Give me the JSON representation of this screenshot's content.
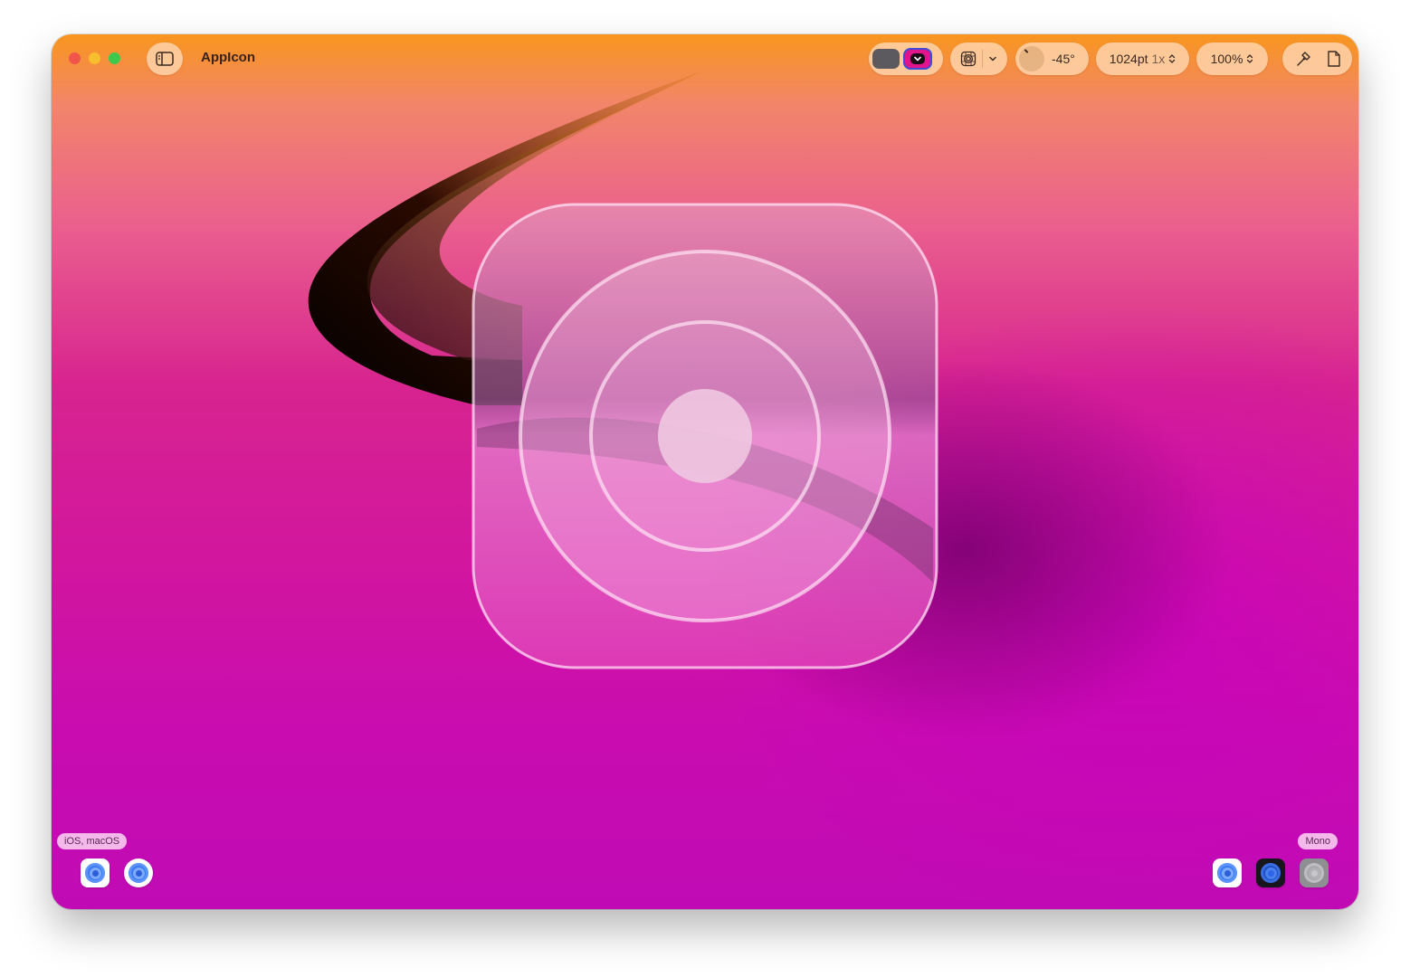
{
  "window": {
    "title": "AppIcon"
  },
  "toolbar": {
    "rotation_value": "-45°",
    "size_label": "1024pt",
    "scale_label": "1x",
    "zoom_label": "100%"
  },
  "platforms": {
    "left_label": "iOS, macOS",
    "right_label": "Mono"
  },
  "icons": {
    "sidebar": "sidebar-toggle-icon",
    "grid": "icon-grid-icon",
    "chevron": "chevron-down-icon",
    "stepper": "up-down-chevron-icon",
    "hammer": "hammer-icon",
    "document": "document-icon"
  },
  "colors": {
    "accent_border": "#3f4bd6",
    "tint_swatch": "#e0148c",
    "dark_swatch": "#5c5a5e",
    "preview_blue": "#3b79f5"
  }
}
